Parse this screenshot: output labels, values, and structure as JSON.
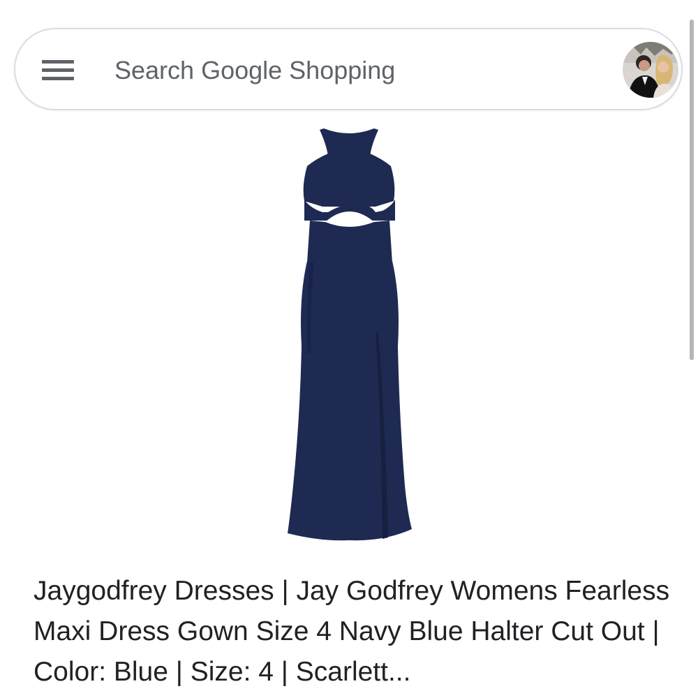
{
  "search": {
    "placeholder": "Search Google Shopping"
  },
  "icons": {
    "menu": "menu-icon",
    "avatar": "profile-avatar"
  },
  "product": {
    "image_alt": "navy-halter-cutout-maxi-dress",
    "dress_color": "#1e2a52",
    "title": "Jaygodfrey Dresses | Jay Godfrey Womens Fearless Maxi Dress Gown Size 4 Navy Blue Halter Cut Out | Color: Blue | Size: 4 | Scarlett..."
  }
}
